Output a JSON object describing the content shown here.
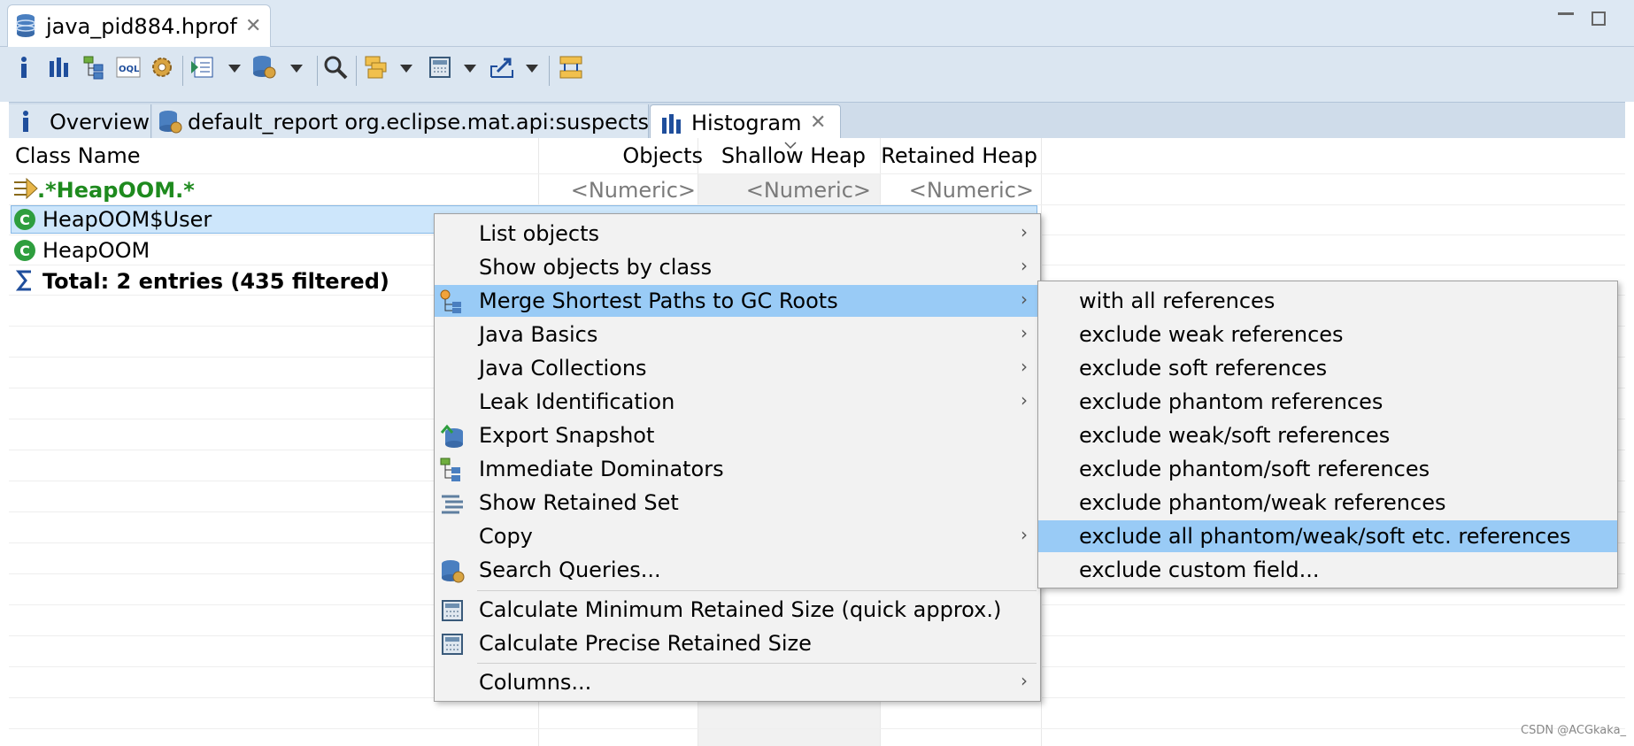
{
  "editor_tab": {
    "title": "java_pid884.hprof",
    "close": "✕"
  },
  "inner_tabs": [
    {
      "label": "Overview"
    },
    {
      "label": "default_report  org.eclipse.mat.api:suspects"
    },
    {
      "label": "Histogram",
      "close": "✕"
    }
  ],
  "table": {
    "columns": [
      "Class Name",
      "Objects",
      "Shallow Heap",
      "Retained Heap"
    ],
    "filter": {
      "class_name": ".*HeapOOM.*",
      "objects": "<Numeric>",
      "shallow": "<Numeric>",
      "retained": "<Numeric>"
    },
    "rows": [
      {
        "class_name": "HeapOOM$User"
      },
      {
        "class_name": "HeapOOM"
      }
    ],
    "total": "Total: 2 entries (435 filtered)"
  },
  "context_menu": {
    "items": [
      {
        "label": "List objects",
        "submenu": true
      },
      {
        "label": "Show objects by class",
        "submenu": true
      },
      {
        "label": "Merge Shortest Paths to GC Roots",
        "submenu": true,
        "highlighted": true
      },
      {
        "label": "Java Basics",
        "submenu": true
      },
      {
        "label": "Java Collections",
        "submenu": true
      },
      {
        "label": "Leak Identification",
        "submenu": true
      },
      {
        "label": "Export Snapshot"
      },
      {
        "label": "Immediate Dominators"
      },
      {
        "label": "Show Retained Set"
      },
      {
        "label": "Copy",
        "submenu": true
      },
      {
        "label": "Search Queries..."
      },
      {
        "label": "Calculate Minimum Retained Size (quick approx.)"
      },
      {
        "label": "Calculate Precise Retained Size"
      },
      {
        "label": "Columns...",
        "submenu": true
      }
    ]
  },
  "submenu": {
    "items": [
      {
        "label": "with all references"
      },
      {
        "label": "exclude weak references"
      },
      {
        "label": "exclude soft references"
      },
      {
        "label": "exclude phantom references"
      },
      {
        "label": "exclude weak/soft references"
      },
      {
        "label": "exclude phantom/soft references"
      },
      {
        "label": "exclude phantom/weak references"
      },
      {
        "label": "exclude all phantom/weak/soft etc. references",
        "highlighted": true
      },
      {
        "label": "exclude custom field..."
      }
    ]
  },
  "arrow_glyph": "›",
  "watermark": "CSDN @ACGkaka_",
  "colors": {
    "highlight": "#99cbf6",
    "filter_green": "#1e8a1e",
    "selection": "#cde6fb"
  }
}
